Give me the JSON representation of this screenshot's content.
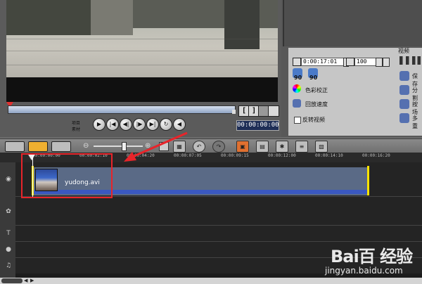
{
  "preview": {
    "project_label": "项目",
    "clip_label": "素材",
    "timecode": "00:00:00:00",
    "mark_in": "[",
    "mark_out": "]"
  },
  "options": {
    "tab_label": "视频",
    "clip_duration": "0:00:17:01",
    "volume": "100",
    "rotate_value_left": "90",
    "rotate_value_right": "90",
    "color_correction": "色彩校正",
    "playback_speed": "回放速度",
    "reverse_video": "反转视频",
    "right_item_1": "保存",
    "right_item_2": "分割",
    "right_item_3": "按场",
    "right_item_4": "多重"
  },
  "ruler": {
    "ticks": [
      "00:00:00:00",
      "00:00:02:10",
      "00:00:04:20",
      "00:00:07:05",
      "00:00:09:15",
      "00:00:12:00",
      "00:00:14:10",
      "00:00:16:20"
    ]
  },
  "timeline": {
    "clip_name": "yudong.avi"
  },
  "watermark": {
    "brand": "Bai百 经验",
    "url": "jingyan.baidu.com"
  },
  "colors": {
    "annotation": "#e8242a",
    "clip_band": "#3a58c0",
    "trim_marker": "#ffe400"
  }
}
